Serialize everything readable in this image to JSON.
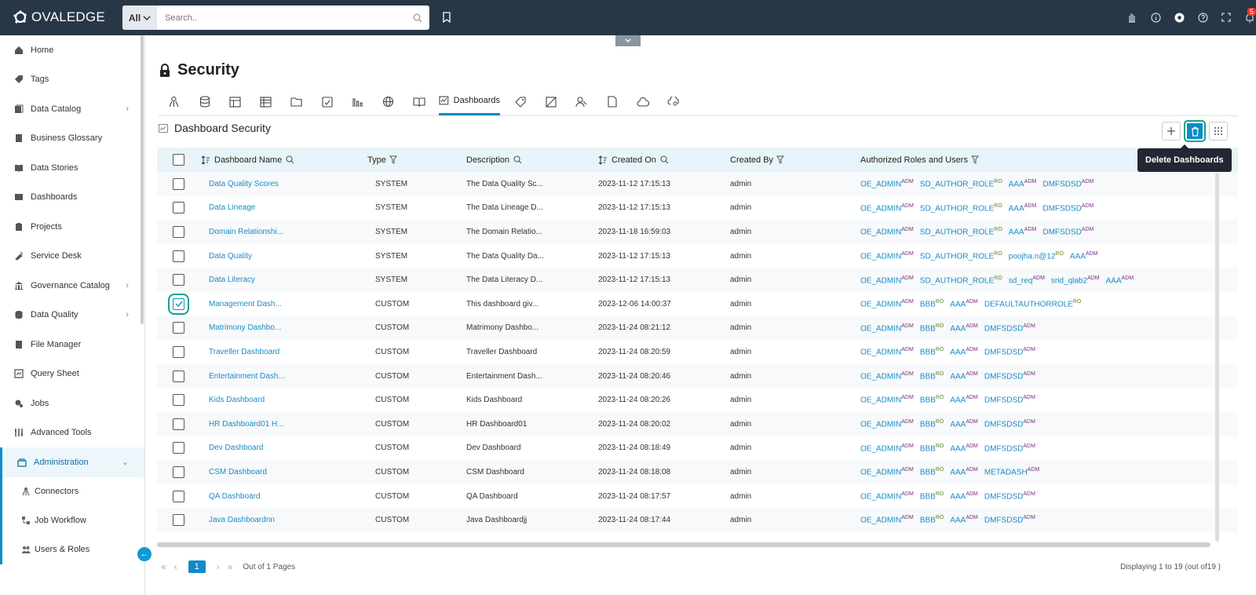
{
  "brand": {
    "name": "OVALEDGE"
  },
  "search": {
    "scope": "All",
    "placeholder": "Search.."
  },
  "topbar": {
    "notification_count": "5"
  },
  "sidebar": {
    "items": [
      {
        "label": "Home",
        "icon": "home-icon",
        "has_chevron": false
      },
      {
        "label": "Tags",
        "icon": "tag-icon",
        "has_chevron": false
      },
      {
        "label": "Data Catalog",
        "icon": "catalog-icon",
        "has_chevron": true
      },
      {
        "label": "Business Glossary",
        "icon": "glossary-icon",
        "has_chevron": false
      },
      {
        "label": "Data Stories",
        "icon": "book-icon",
        "has_chevron": false
      },
      {
        "label": "Dashboards",
        "icon": "dashboard-icon",
        "has_chevron": false
      },
      {
        "label": "Projects",
        "icon": "projects-icon",
        "has_chevron": false
      },
      {
        "label": "Service Desk",
        "icon": "service-desk-icon",
        "has_chevron": false
      },
      {
        "label": "Governance Catalog",
        "icon": "governance-icon",
        "has_chevron": true
      },
      {
        "label": "Data Quality",
        "icon": "data-quality-icon",
        "has_chevron": true
      },
      {
        "label": "File Manager",
        "icon": "file-manager-icon",
        "has_chevron": false
      },
      {
        "label": "Query Sheet",
        "icon": "query-sheet-icon",
        "has_chevron": false
      },
      {
        "label": "Jobs",
        "icon": "jobs-icon",
        "has_chevron": false
      },
      {
        "label": "Advanced Tools",
        "icon": "tools-icon",
        "has_chevron": false
      }
    ],
    "active": {
      "label": "Administration",
      "icon": "admin-icon"
    },
    "sub_items": [
      {
        "label": "Connectors",
        "icon": "connectors-icon"
      },
      {
        "label": "Job Workflow",
        "icon": "workflow-icon"
      },
      {
        "label": "Users & Roles",
        "icon": "users-icon"
      }
    ]
  },
  "page": {
    "title": "Security",
    "active_tab": "Dashboards",
    "section_title": "Dashboard Security"
  },
  "tooltip": {
    "text": "Delete Dashboards"
  },
  "table": {
    "headers": {
      "name": "Dashboard Name",
      "type": "Type",
      "description": "Description",
      "created_on": "Created On",
      "created_by": "Created By",
      "roles": "Authorized Roles and Users"
    },
    "rows": [
      {
        "name": "Data Quality Scores",
        "type": "SYSTEM",
        "description": "The Data Quality Sc...",
        "created_on": "2023-11-12 17:15:13",
        "created_by": "admin",
        "checked": false,
        "roles": [
          {
            "n": "OE_ADMIN",
            "s": "ADM"
          },
          {
            "n": "SD_AUTHOR_ROLE",
            "s": "RO"
          },
          {
            "n": "AAA",
            "s": "ADM"
          },
          {
            "n": "DMFSDSD",
            "s": "ADM"
          }
        ]
      },
      {
        "name": "Data Lineage",
        "type": "SYSTEM",
        "description": "The Data Lineage D...",
        "created_on": "2023-11-12 17:15:13",
        "created_by": "admin",
        "checked": false,
        "roles": [
          {
            "n": "OE_ADMIN",
            "s": "ADM"
          },
          {
            "n": "SD_AUTHOR_ROLE",
            "s": "RO"
          },
          {
            "n": "AAA",
            "s": "ADM"
          },
          {
            "n": "DMFSDSD",
            "s": "ADM"
          }
        ]
      },
      {
        "name": "Domain Relationshi...",
        "type": "SYSTEM",
        "description": "The Domain Relatio...",
        "created_on": "2023-11-18 16:59:03",
        "created_by": "admin",
        "checked": false,
        "roles": [
          {
            "n": "OE_ADMIN",
            "s": "ADM"
          },
          {
            "n": "SD_AUTHOR_ROLE",
            "s": "RO"
          },
          {
            "n": "AAA",
            "s": "ADM"
          },
          {
            "n": "DMFSDSD",
            "s": "ADM"
          }
        ]
      },
      {
        "name": "Data Quality",
        "type": "SYSTEM",
        "description": "The Data Quality Da...",
        "created_on": "2023-11-12 17:15:13",
        "created_by": "admin",
        "checked": false,
        "roles": [
          {
            "n": "OE_ADMIN",
            "s": "ADM"
          },
          {
            "n": "SD_AUTHOR_ROLE",
            "s": "RO"
          },
          {
            "n": "poojha.n@12",
            "s": "RO"
          },
          {
            "n": "AAA",
            "s": "ADM"
          }
        ]
      },
      {
        "name": "Data Literacy",
        "type": "SYSTEM",
        "description": "The Data Literacy D...",
        "created_on": "2023-11-12 17:15:13",
        "created_by": "admin",
        "checked": false,
        "roles": [
          {
            "n": "OE_ADMIN",
            "s": "ADM"
          },
          {
            "n": "SD_AUTHOR_ROLE",
            "s": "RO"
          },
          {
            "n": "sd_req",
            "s": "ADM"
          },
          {
            "n": "srid_qlab2",
            "s": "ADM"
          },
          {
            "n": "AAA",
            "s": "ADM"
          }
        ]
      },
      {
        "name": "Management Dash...",
        "type": "CUSTOM",
        "description": "This dashboard giv...",
        "created_on": "2023-12-06 14:00:37",
        "created_by": "admin",
        "checked": true,
        "roles": [
          {
            "n": "OE_ADMIN",
            "s": "ADM"
          },
          {
            "n": "BBB",
            "s": "RO"
          },
          {
            "n": "AAA",
            "s": "ADM"
          },
          {
            "n": "DEFAULTAUTHORROLE",
            "s": "RO"
          }
        ]
      },
      {
        "name": "Matrimony Dashbo...",
        "type": "CUSTOM",
        "description": "Matrimony Dashbo...",
        "created_on": "2023-11-24 08:21:12",
        "created_by": "admin",
        "checked": false,
        "roles": [
          {
            "n": "OE_ADMIN",
            "s": "ADM"
          },
          {
            "n": "BBB",
            "s": "RO"
          },
          {
            "n": "AAA",
            "s": "ADM"
          },
          {
            "n": "DMFSDSD",
            "s": "ADM"
          }
        ]
      },
      {
        "name": "Traveller Dashboard",
        "type": "CUSTOM",
        "description": "Traveller Dashboard",
        "created_on": "2023-11-24 08:20:59",
        "created_by": "admin",
        "checked": false,
        "roles": [
          {
            "n": "OE_ADMIN",
            "s": "ADM"
          },
          {
            "n": "BBB",
            "s": "RO"
          },
          {
            "n": "AAA",
            "s": "ADM"
          },
          {
            "n": "DMFSDSD",
            "s": "ADM"
          }
        ]
      },
      {
        "name": "Entertainment Dash...",
        "type": "CUSTOM",
        "description": "Entertainment Dash...",
        "created_on": "2023-11-24 08:20:46",
        "created_by": "admin",
        "checked": false,
        "roles": [
          {
            "n": "OE_ADMIN",
            "s": "ADM"
          },
          {
            "n": "BBB",
            "s": "RO"
          },
          {
            "n": "AAA",
            "s": "ADM"
          },
          {
            "n": "DMFSDSD",
            "s": "ADM"
          }
        ]
      },
      {
        "name": "Kids Dashboard",
        "type": "CUSTOM",
        "description": "Kids Dashboard",
        "created_on": "2023-11-24 08:20:26",
        "created_by": "admin",
        "checked": false,
        "roles": [
          {
            "n": "OE_ADMIN",
            "s": "ADM"
          },
          {
            "n": "BBB",
            "s": "RO"
          },
          {
            "n": "AAA",
            "s": "ADM"
          },
          {
            "n": "DMFSDSD",
            "s": "ADM"
          }
        ]
      },
      {
        "name": "HR Dashboard01 H...",
        "type": "CUSTOM",
        "description": "HR Dashboard01",
        "created_on": "2023-11-24 08:20:02",
        "created_by": "admin",
        "checked": false,
        "roles": [
          {
            "n": "OE_ADMIN",
            "s": "ADM"
          },
          {
            "n": "BBB",
            "s": "RO"
          },
          {
            "n": "AAA",
            "s": "ADM"
          },
          {
            "n": "DMFSDSD",
            "s": "ADM"
          }
        ]
      },
      {
        "name": "Dev Dashboard",
        "type": "CUSTOM",
        "description": "Dev Dashboard",
        "created_on": "2023-11-24 08:18:49",
        "created_by": "admin",
        "checked": false,
        "roles": [
          {
            "n": "OE_ADMIN",
            "s": "ADM"
          },
          {
            "n": "BBB",
            "s": "RO"
          },
          {
            "n": "AAA",
            "s": "ADM"
          },
          {
            "n": "DMFSDSD",
            "s": "ADM"
          }
        ]
      },
      {
        "name": "CSM Dashboard",
        "type": "CUSTOM",
        "description": "CSM Dashboard",
        "created_on": "2023-11-24 08:18:08",
        "created_by": "admin",
        "checked": false,
        "roles": [
          {
            "n": "OE_ADMIN",
            "s": "ADM"
          },
          {
            "n": "BBB",
            "s": "RO"
          },
          {
            "n": "AAA",
            "s": "ADM"
          },
          {
            "n": "METADASH",
            "s": "ADM"
          }
        ]
      },
      {
        "name": "QA Dashboard",
        "type": "CUSTOM",
        "description": "QA Dashboard",
        "created_on": "2023-11-24 08:17:57",
        "created_by": "admin",
        "checked": false,
        "roles": [
          {
            "n": "OE_ADMIN",
            "s": "ADM"
          },
          {
            "n": "BBB",
            "s": "RO"
          },
          {
            "n": "AAA",
            "s": "ADM"
          },
          {
            "n": "DMFSDSD",
            "s": "ADM"
          }
        ]
      },
      {
        "name": "Java Dashboardnn",
        "type": "CUSTOM",
        "description": "Java Dashboardjj",
        "created_on": "2023-11-24 08:17:44",
        "created_by": "admin",
        "checked": false,
        "roles": [
          {
            "n": "OE_ADMIN",
            "s": "ADM"
          },
          {
            "n": "BBB",
            "s": "RO"
          },
          {
            "n": "AAA",
            "s": "ADM"
          },
          {
            "n": "DMFSDSD",
            "s": "ADM"
          }
        ]
      }
    ]
  },
  "pager": {
    "page": "1",
    "out_of": "Out of 1 Pages",
    "displaying": "Displaying 1 to 19  (out of19 )"
  }
}
